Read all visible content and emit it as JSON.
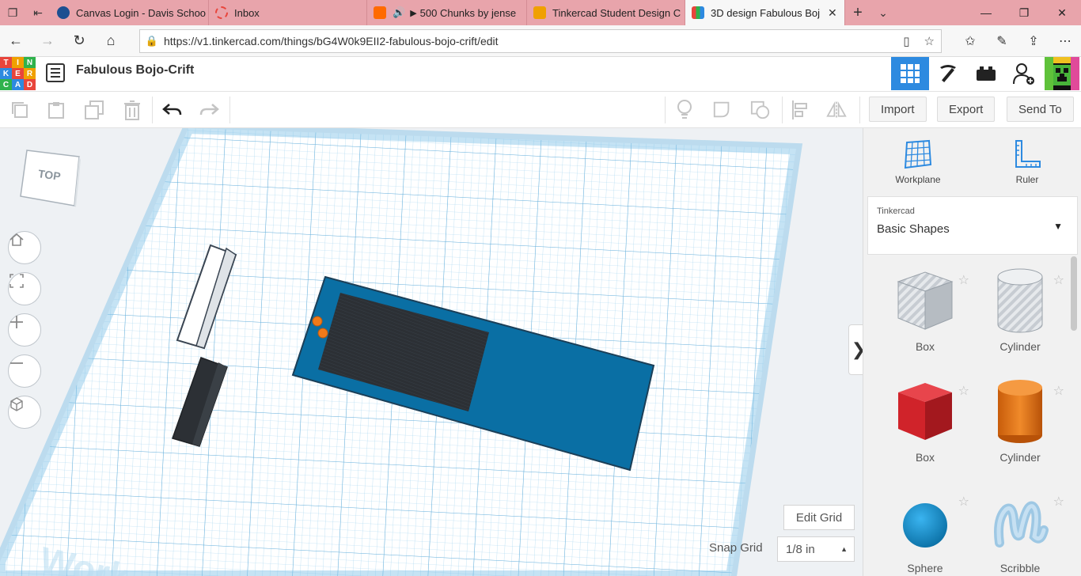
{
  "browser": {
    "tabs": [
      {
        "title": "Canvas Login - Davis Schoo",
        "fav_color": "#1d4f91"
      },
      {
        "title": "Inbox",
        "fav_color": "#e8453c"
      },
      {
        "title": "500 Chunks by jense",
        "fav_color": "#ff6a00",
        "audio": "🔊",
        "play": "▶"
      },
      {
        "title": "Tinkercad Student Design C",
        "fav_color": "#f0a000"
      },
      {
        "title": "3D design Fabulous Boj",
        "fav_color": "#2d8ae0"
      }
    ],
    "url": "https://v1.tinkercad.com/things/bG4W0k9EII2-fabulous-bojo-crift/edit"
  },
  "header": {
    "logo_letters": [
      "T",
      "I",
      "N",
      "K",
      "E",
      "R",
      "C",
      "A",
      "D"
    ],
    "logo_colors": [
      "#e8453c",
      "#f0a000",
      "#2fb24c",
      "#2d8ae0",
      "#e8453c",
      "#f0a000",
      "#2fb24c",
      "#2d8ae0",
      "#e8453c"
    ],
    "design_title": "Fabulous Bojo-Crift"
  },
  "toolbar": {
    "import_label": "Import",
    "export_label": "Export",
    "send_to_label": "Send To"
  },
  "workspace": {
    "view_cube_label": "TOP",
    "workplane_watermark": "Work",
    "edit_grid_label": "Edit Grid",
    "snap_grid_label": "Snap Grid",
    "snap_grid_value": "1/8 in"
  },
  "panel": {
    "workplane_label": "Workplane",
    "ruler_label": "Ruler",
    "library_category": "Tinkercad",
    "library_name": "Basic Shapes",
    "shapes": [
      {
        "label": "Box",
        "kind": "box-hole"
      },
      {
        "label": "Cylinder",
        "kind": "cylinder-hole"
      },
      {
        "label": "Box",
        "kind": "box-solid"
      },
      {
        "label": "Cylinder",
        "kind": "cylinder-solid"
      },
      {
        "label": "Sphere",
        "kind": "sphere"
      },
      {
        "label": "Scribble",
        "kind": "scribble"
      }
    ]
  },
  "colors": {
    "accent": "#2d8ae0",
    "model_blue": "#0a6fa4",
    "dark_panel": "#2c3035",
    "orange": "#f07a1a",
    "red_box": "#d0232a"
  }
}
